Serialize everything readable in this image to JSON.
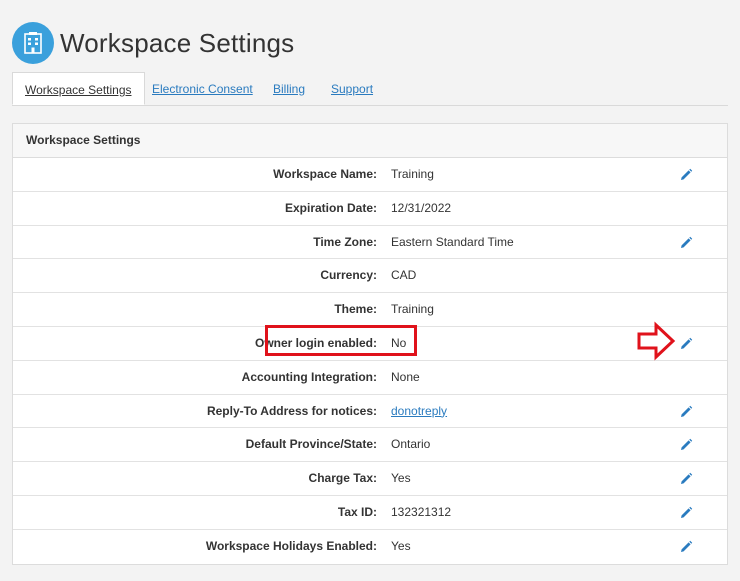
{
  "page": {
    "title": "Workspace Settings",
    "logo_icon": "building-icon"
  },
  "tabs": [
    {
      "label": "Workspace Settings",
      "active": true
    },
    {
      "label": "Electronic Consent",
      "active": false
    },
    {
      "label": "Billing",
      "active": false
    },
    {
      "label": "Support",
      "active": false
    }
  ],
  "panel": {
    "heading": "Workspace Settings",
    "rows": [
      {
        "label": "Workspace Name:",
        "value": "Training",
        "editable": true
      },
      {
        "label": "Expiration Date:",
        "value": "12/31/2022",
        "editable": false
      },
      {
        "label": "Time Zone:",
        "value": "Eastern Standard Time",
        "editable": true
      },
      {
        "label": "Currency:",
        "value": "CAD",
        "editable": false
      },
      {
        "label": "Theme:",
        "value": "Training",
        "editable": false
      },
      {
        "label": "Owner login enabled:",
        "value": "No",
        "editable": true
      },
      {
        "label": "Accounting Integration:",
        "value": "None",
        "editable": false
      },
      {
        "label": "Reply-To Address for notices:",
        "value": "donotreply",
        "editable": true,
        "link": true
      },
      {
        "label": "Default Province/State:",
        "value": "Ontario",
        "editable": true
      },
      {
        "label": "Charge Tax:",
        "value": "Yes",
        "editable": true
      },
      {
        "label": "Tax ID:",
        "value": "132321312",
        "editable": true
      },
      {
        "label": "Workspace Holidays Enabled:",
        "value": "Yes",
        "editable": true
      }
    ]
  },
  "colors": {
    "accent": "#2a7bbf",
    "logo_bg": "#3aa0dc",
    "highlight": "#e0121b"
  }
}
